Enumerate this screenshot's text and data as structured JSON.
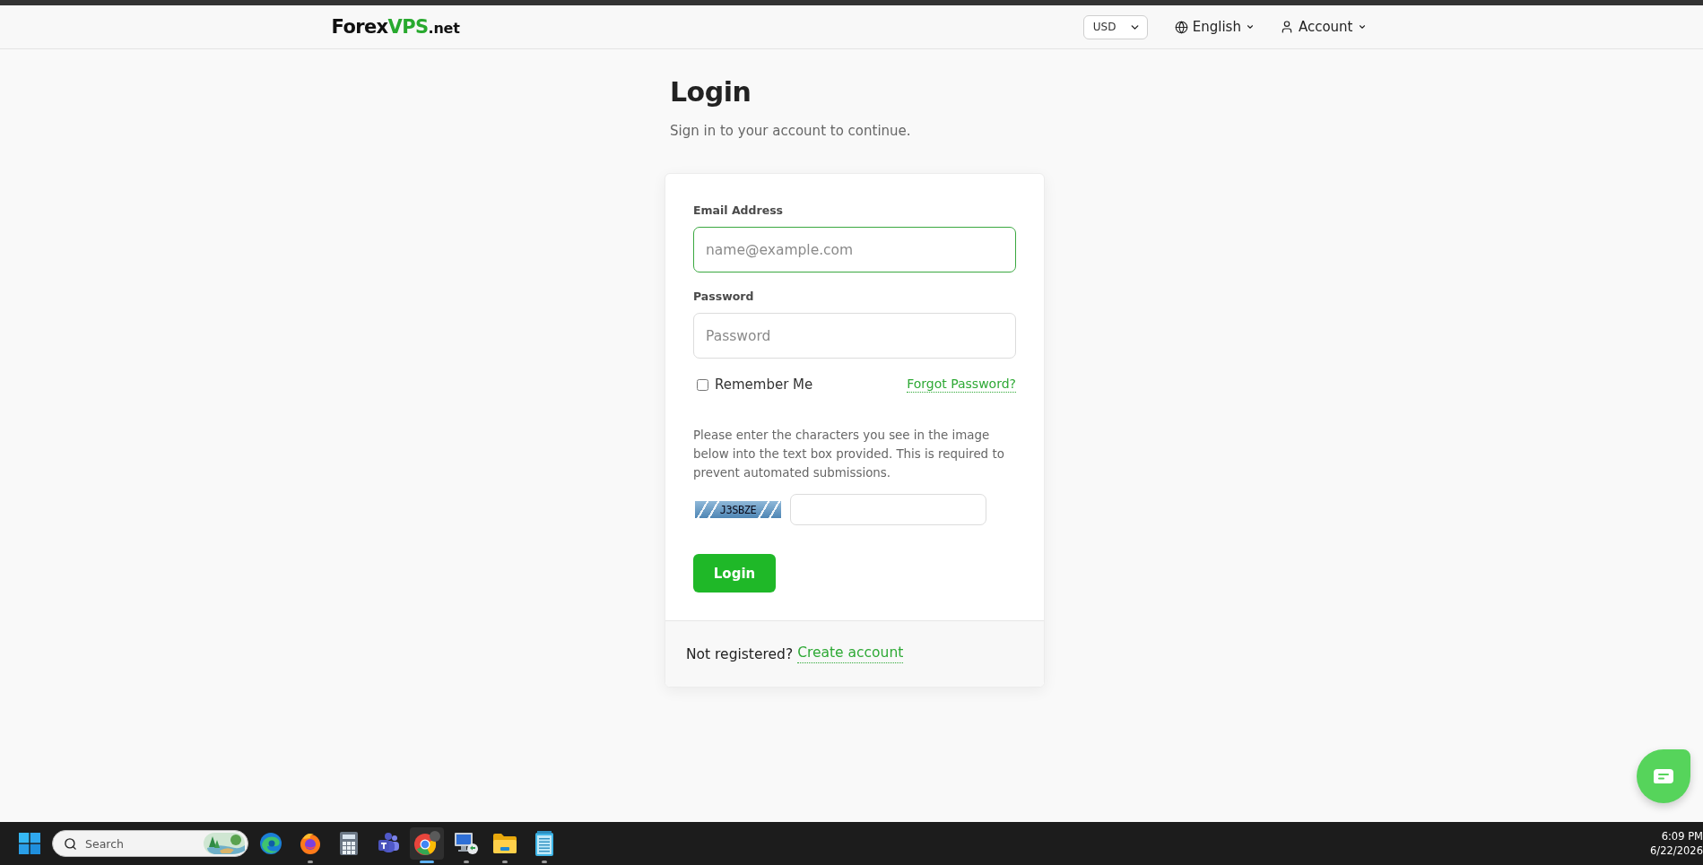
{
  "header": {
    "logo": {
      "brand": "Forex",
      "highlight": "VPS",
      "suffix": ".net"
    },
    "currency": {
      "value": "USD"
    },
    "language": {
      "label": "English"
    },
    "account": {
      "label": "Account"
    }
  },
  "login": {
    "title": "Login",
    "subtitle": "Sign in to your account to continue.",
    "fields": [
      {
        "label": "Email Address",
        "placeholder": "name@example.com",
        "focused": true
      },
      {
        "label": "Password",
        "placeholder": "Password",
        "focused": false
      }
    ],
    "remember_me": {
      "label": "Remember Me",
      "checked": false
    },
    "forgot_password": "Forgot Password?",
    "captcha": {
      "instructions": "Please enter the characters you see in the image below into the text box provided. This is required to prevent automated submissions.",
      "image_text": "J3SBZE"
    },
    "submit": "Login",
    "footer": {
      "prompt": "Not registered?",
      "link": "Create account"
    }
  },
  "taskbar": {
    "search": {
      "placeholder": "Search"
    },
    "apps": [
      {
        "kind": "edge",
        "running": false,
        "selected": false
      },
      {
        "kind": "firefox",
        "running": true,
        "selected": false
      },
      {
        "kind": "calculator",
        "running": false,
        "selected": false
      },
      {
        "kind": "teams",
        "running": false,
        "selected": false
      },
      {
        "kind": "chrome",
        "running": true,
        "selected": true
      },
      {
        "kind": "rdp",
        "running": true,
        "selected": false
      },
      {
        "kind": "explorer",
        "running": true,
        "selected": false
      },
      {
        "kind": "notepad",
        "running": true,
        "selected": false
      }
    ],
    "clock": {
      "time": "6:09 PM",
      "date": "6/22/2026"
    }
  }
}
